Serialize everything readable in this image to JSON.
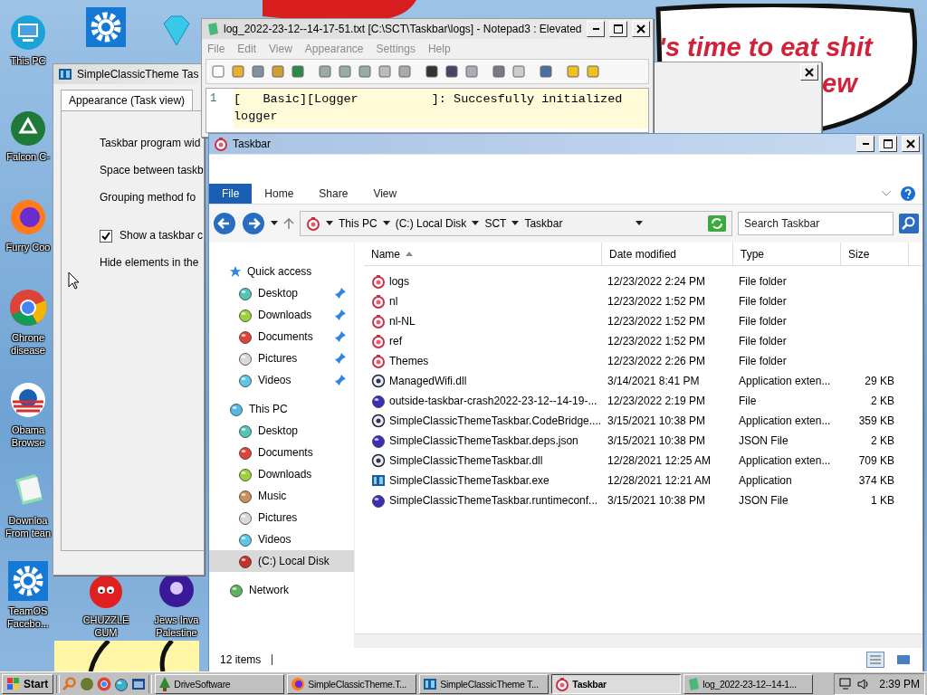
{
  "desktop_icons": [
    {
      "kind": "monitor",
      "label": [
        "This PC"
      ]
    },
    {
      "kind": "gear"
    },
    {
      "kind": "diamond"
    },
    {
      "kind": "recycle",
      "label": [
        "Falcon C-"
      ]
    },
    {
      "kind": "firefox",
      "label": [
        "Furry Coo"
      ]
    },
    {
      "kind": "chrome",
      "label": [
        "Chrone",
        "disease"
      ]
    },
    {
      "kind": "obama",
      "label": [
        "Obama",
        "Browse"
      ]
    },
    {
      "kind": "notes",
      "label": [
        "Downloa",
        "From tean"
      ]
    },
    {
      "kind": "gear",
      "label": [
        "TeamOS",
        "Facebo..."
      ]
    },
    {
      "kind": "ball",
      "label": [
        "CHUZZLE",
        "CUM"
      ]
    },
    {
      "kind": "orb",
      "label": [
        "Jews Inva",
        "Palestine"
      ]
    }
  ],
  "wallpaper": {
    "texts": [
      "'s time to eat shit",
      "ew"
    ]
  },
  "settings_window": {
    "title": "SimpleClassicTheme Tas",
    "tab": "Appearance (Task view)",
    "options": [
      {
        "kind": "label",
        "text": "Taskbar program wid"
      },
      {
        "kind": "label",
        "text": "Space between taskb"
      },
      {
        "kind": "label",
        "text": "Grouping method fo"
      },
      {
        "kind": "checkbox",
        "text": "Show a taskbar c",
        "checked": true
      },
      {
        "kind": "label",
        "text": "Hide elements in the"
      }
    ]
  },
  "notepad": {
    "title": "log_2022-23-12--14-17-51.txt [C:\\SCT\\Taskbar\\logs] - Notepad3 : Elevated",
    "menu": [
      "File",
      "Edit",
      "View",
      "Appearance",
      "Settings",
      "Help"
    ],
    "lines": [
      {
        "number": "1",
        "text": "[   Basic][Logger          ]: Succesfully initialized",
        "wrap": "logger"
      }
    ]
  },
  "explorer": {
    "title": "Taskbar",
    "ribbon_tabs": [
      {
        "label": "File",
        "selected": true
      },
      {
        "label": "Home",
        "selected": false
      },
      {
        "label": "Share",
        "selected": false
      },
      {
        "label": "View",
        "selected": false
      }
    ],
    "breadcrumbs": [
      "This PC",
      "(C:) Local Disk",
      "SCT",
      "Taskbar"
    ],
    "search": {
      "placeholder": "Search Taskbar"
    },
    "nav": [
      {
        "label": "Quick access",
        "kind": "star",
        "selected": false,
        "children": [
          {
            "label": "Desktop",
            "kind": "desktop",
            "selected": false,
            "pinned": true
          },
          {
            "label": "Downloads",
            "kind": "downloads",
            "selected": false,
            "pinned": true
          },
          {
            "label": "Documents",
            "kind": "documents",
            "selected": false,
            "pinned": true
          },
          {
            "label": "Pictures",
            "kind": "pictures",
            "selected": false,
            "pinned": true
          },
          {
            "label": "Videos",
            "kind": "videos",
            "selected": false,
            "pinned": true
          }
        ]
      },
      {
        "label": "This PC",
        "kind": "pc",
        "selected": false,
        "children": [
          {
            "label": "Desktop",
            "kind": "desktop",
            "selected": false,
            "pinned": false
          },
          {
            "label": "Documents",
            "kind": "documents",
            "selected": false,
            "pinned": false
          },
          {
            "label": "Downloads",
            "kind": "downloads",
            "selected": false,
            "pinned": false
          },
          {
            "label": "Music",
            "kind": "music",
            "selected": false,
            "pinned": false
          },
          {
            "label": "Pictures",
            "kind": "pictures",
            "selected": false,
            "pinned": false
          },
          {
            "label": "Videos",
            "kind": "videos",
            "selected": false,
            "pinned": false
          },
          {
            "label": "(C:) Local Disk",
            "kind": "disk",
            "selected": true,
            "pinned": false
          }
        ]
      },
      {
        "label": "Network",
        "kind": "network",
        "selected": false
      }
    ],
    "columns": [
      {
        "label": "Name",
        "sorted": true
      },
      {
        "label": "Date modified",
        "sorted": false
      },
      {
        "label": "Type",
        "sorted": false
      },
      {
        "label": "Size",
        "sorted": false
      }
    ],
    "rows": [
      {
        "kind": "folder",
        "name": "logs",
        "date": "12/23/2022 2:24 PM",
        "type": "File folder"
      },
      {
        "kind": "folder",
        "name": "nl",
        "date": "12/23/2022 1:52 PM",
        "type": "File folder"
      },
      {
        "kind": "folder",
        "name": "nl-NL",
        "date": "12/23/2022 1:52 PM",
        "type": "File folder"
      },
      {
        "kind": "folder",
        "name": "ref",
        "date": "12/23/2022 1:52 PM",
        "type": "File folder"
      },
      {
        "kind": "folder",
        "name": "Themes",
        "date": "12/23/2022 2:26 PM",
        "type": "File folder"
      },
      {
        "kind": "dll",
        "name": "ManagedWifi.dll",
        "date": "3/14/2021 8:41 PM",
        "type": "Application exten...",
        "size": "29 KB"
      },
      {
        "kind": "file",
        "name": "outside-taskbar-crash2022-23-12--14-19-...",
        "date": "12/23/2022 2:19 PM",
        "type": "File",
        "size": "2 KB"
      },
      {
        "kind": "dll",
        "name": "SimpleClassicThemeTaskbar.CodeBridge....",
        "date": "3/15/2021 10:38 PM",
        "type": "Application exten...",
        "size": "359 KB"
      },
      {
        "kind": "file",
        "name": "SimpleClassicThemeTaskbar.deps.json",
        "date": "3/15/2021 10:38 PM",
        "type": "JSON File",
        "size": "2 KB"
      },
      {
        "kind": "dll",
        "name": "SimpleClassicThemeTaskbar.dll",
        "date": "12/28/2021 12:25 AM",
        "type": "Application exten...",
        "size": "709 KB"
      },
      {
        "kind": "exe",
        "name": "SimpleClassicThemeTaskbar.exe",
        "date": "12/28/2021 12:21 AM",
        "type": "Application",
        "size": "374 KB"
      },
      {
        "kind": "file",
        "name": "SimpleClassicThemeTaskbar.runtimeconf...",
        "date": "3/15/2021 10:38 PM",
        "type": "JSON File",
        "size": "1 KB"
      }
    ],
    "status": "12 items"
  },
  "taskbar": {
    "start": "Start",
    "buttons": [
      {
        "kind": "tree",
        "label": "DriveSoftware",
        "selected": false
      },
      {
        "kind": "firefox",
        "label": "SimpleClassicTheme.T...",
        "selected": false
      },
      {
        "kind": "exe",
        "label": "SimpleClassicTheme T...",
        "selected": false
      },
      {
        "kind": "folder",
        "label": "Taskbar",
        "selected": true
      },
      {
        "kind": "notes",
        "label": "log_2022-23-12--14-1...",
        "selected": false
      }
    ],
    "clock": "2:39 PM"
  }
}
